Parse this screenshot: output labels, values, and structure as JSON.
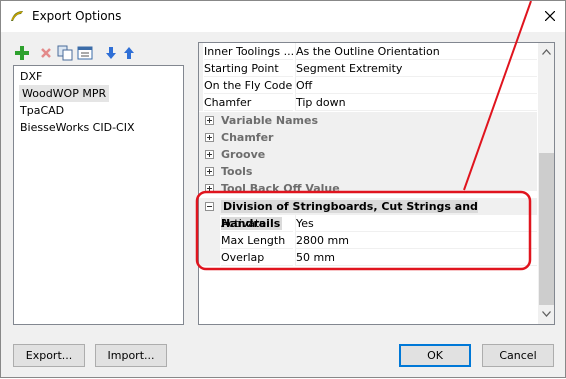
{
  "window": {
    "title": "Export Options",
    "close_symbol": "close-icon"
  },
  "toolbar": {
    "icons": [
      "add-icon",
      "delete-icon",
      "copy-icon",
      "properties-icon",
      "move-down-icon",
      "move-up-icon"
    ]
  },
  "left_list": {
    "items": [
      "DXF",
      "WoodWOP MPR",
      "TpaCAD",
      "BiesseWorks CID-CIX"
    ],
    "selected": "WoodWOP MPR"
  },
  "grid": {
    "rows": [
      {
        "key": "Inner Toolings ...",
        "value": "As the Outline Orientation"
      },
      {
        "key": "Starting Point",
        "value": "Segment Extremity"
      },
      {
        "key": "On the Fly Code",
        "value": "Off"
      },
      {
        "key": "Chamfer",
        "value": "Tip down"
      }
    ],
    "categories": [
      "Variable Names",
      "Chamfer",
      "Groove",
      "Tools",
      "Tool Back Off Value"
    ],
    "open_category": "Division of Stringboards, Cut Strings and Handrails",
    "sub_rows": [
      {
        "key": "Activate",
        "value": "Yes"
      },
      {
        "key": "Max Length",
        "value": "2800 mm"
      },
      {
        "key": "Overlap",
        "value": "50 mm"
      }
    ]
  },
  "buttons": {
    "export": "Export...",
    "import": "Import...",
    "ok": "OK",
    "cancel": "Cancel"
  },
  "annotation": {
    "color": "#e0141e"
  }
}
